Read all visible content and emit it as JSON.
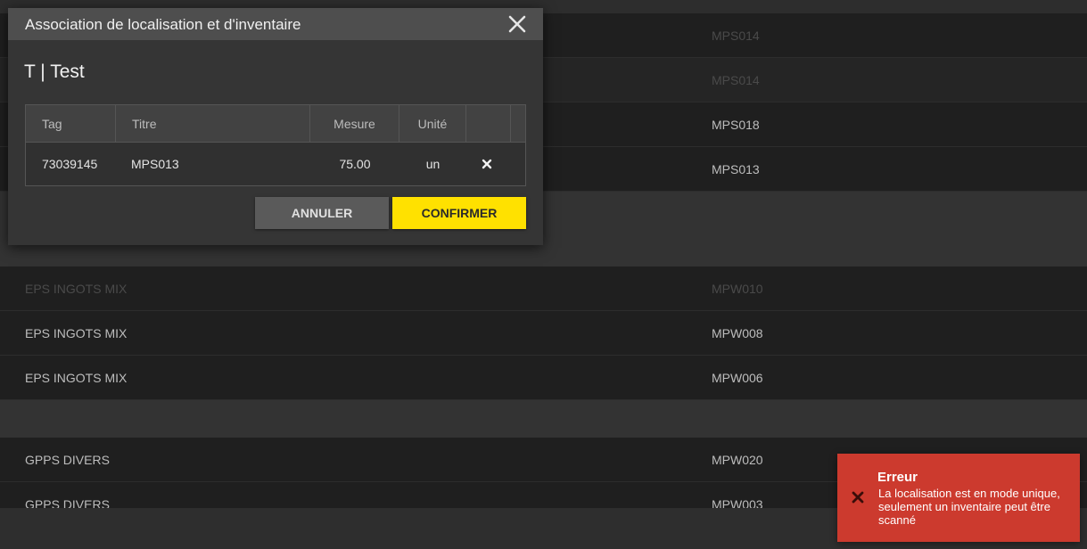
{
  "background_list": {
    "rows": [
      {
        "col1": "",
        "col2": "MPS014"
      },
      {
        "col1": "",
        "col2": "MPS014"
      },
      {
        "col1": "",
        "col2": "MPS018"
      },
      {
        "col1": "",
        "col2": "MPS013"
      },
      {
        "col1": "EPS INGOTS MIX",
        "col2": "MPW010"
      },
      {
        "col1": "EPS INGOTS MIX",
        "col2": "MPW008"
      },
      {
        "col1": "EPS INGOTS MIX",
        "col2": "MPW006"
      },
      {
        "col1": "GPPS DIVERS",
        "col2": "MPW020"
      },
      {
        "col1": "GPPS DIVERS",
        "col2": "MPW003"
      }
    ]
  },
  "modal": {
    "title": "Association de localisation et d'inventaire",
    "close_icon": "close-icon",
    "subtitle": "T | Test",
    "table": {
      "headers": {
        "tag": "Tag",
        "titre": "Titre",
        "mesure": "Mesure",
        "unite": "Unité"
      },
      "rows": [
        {
          "tag": "73039145",
          "titre": "MPS013",
          "mesure": "75.00",
          "unite": "un",
          "remove_icon": "close-icon"
        }
      ]
    },
    "cancel_label": "ANNULER",
    "confirm_label": "CONFIRMER"
  },
  "toast": {
    "icon": "close-icon",
    "title": "Erreur",
    "message": "La localisation est en mode unique, seulement un inventaire peut être scanné"
  },
  "colors": {
    "accent": "#ffe100",
    "error": "#cc3a2e",
    "modal_header": "#4e4e4e",
    "modal_body": "#353535"
  }
}
